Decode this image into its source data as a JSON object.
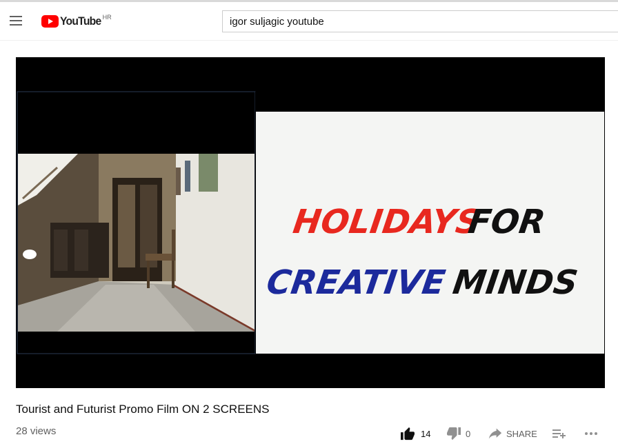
{
  "header": {
    "logo_text": "YouTube",
    "country_code": "HR",
    "search_value": "igor suljagic youtube"
  },
  "video": {
    "title": "Tourist and Futurist Promo Film ON 2 SCREENS",
    "views": "28 views",
    "screen_text_line1_word1": "HOLIDAYS",
    "screen_text_line1_word2": "FOR",
    "screen_text_line2_word1": "CREATIVE",
    "screen_text_line2_word2": "MINDS"
  },
  "actions": {
    "like_count": "14",
    "dislike_count": "0",
    "share_label": "SHARE"
  },
  "colors": {
    "brand_red": "#ff0000",
    "text_red": "#e8281f",
    "text_blue": "#1c2a9c",
    "text_black": "#111111"
  },
  "icons": [
    "menu-icon",
    "youtube-logo-icon",
    "thumbs-up-icon",
    "thumbs-down-icon",
    "share-icon",
    "add-to-playlist-icon",
    "more-icon"
  ]
}
